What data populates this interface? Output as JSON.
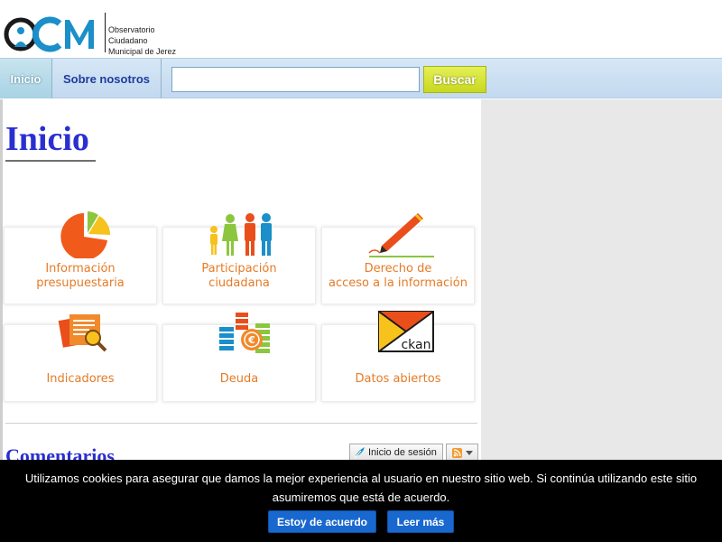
{
  "logo": {
    "brand": "OCM",
    "line1": "Observatorio",
    "line2": "Ciudadano",
    "line3": "Municipal de Jerez"
  },
  "nav": {
    "home_label": "Inicio",
    "about_label": "Sobre nosotros",
    "search_value": "",
    "search_button": "Buscar"
  },
  "main": {
    "title": "Inicio",
    "tiles": [
      {
        "line1": "Información",
        "line2": "presupuestaria",
        "icon": "pie-chart-icon"
      },
      {
        "line1": "Participación",
        "line2": "ciudadana",
        "icon": "people-icon"
      },
      {
        "line1": "Derecho de",
        "line2": "acceso a la información",
        "icon": "pen-icon"
      },
      {
        "line1": "Indicadores",
        "line2": "",
        "icon": "documents-search-icon"
      },
      {
        "line1": "Deuda",
        "line2": "",
        "icon": "coins-euro-icon"
      },
      {
        "line1": "Datos abiertos",
        "line2": "",
        "icon": "ckan-icon"
      }
    ],
    "ckan_label": "ckan",
    "comments_title": "Comentarios",
    "login_label": "Inicio de sesión"
  },
  "cookie": {
    "text": "Utilizamos cookies para asegurar que damos la mejor experiencia al usuario en nuestro sitio web. Si continúa utilizando este sitio asumiremos que está de acuerdo.",
    "accept_label": "Estoy de acuerdo",
    "more_label": "Leer más"
  },
  "colors": {
    "title_blue": "#2a2fd1",
    "tile_orange": "#e67b26",
    "search_button": "#c9d81f",
    "cookie_button": "#1968cf"
  }
}
